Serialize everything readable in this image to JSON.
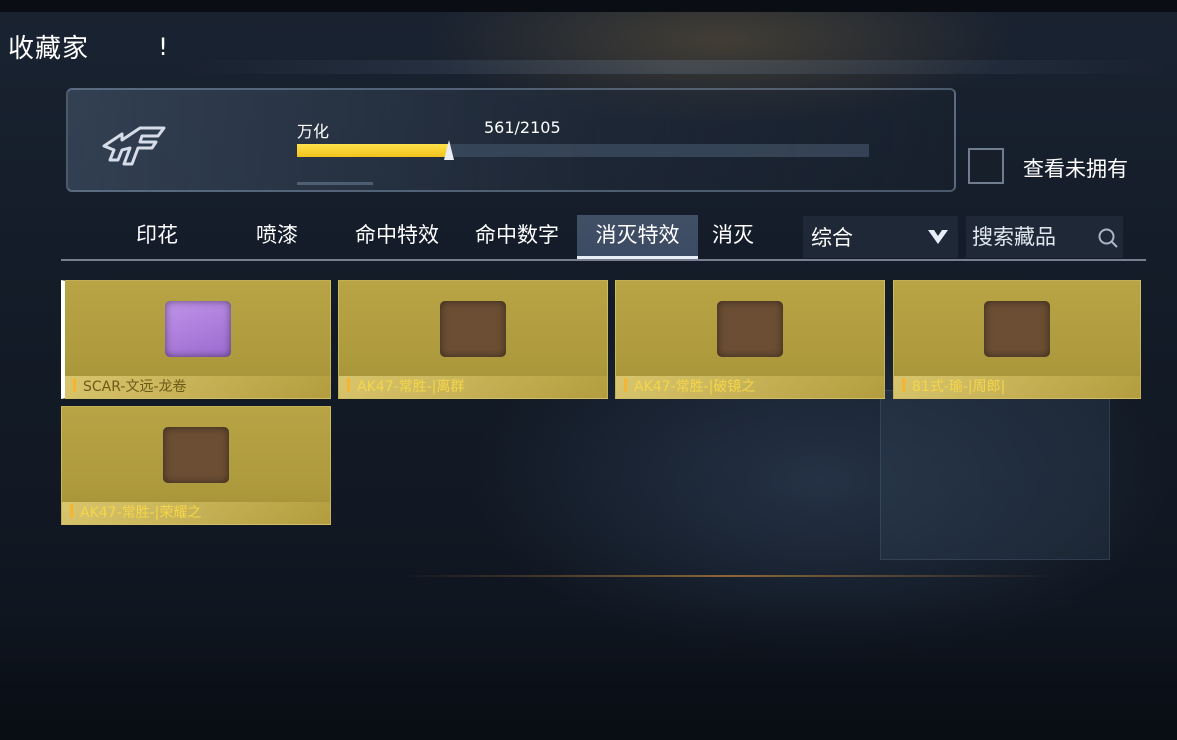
{
  "page": {
    "title": "收藏家",
    "info_icon": "info-icon"
  },
  "header": {
    "emblem_icon": "collector-emblem-icon",
    "progress_label": "万化",
    "progress_count": "561/2105",
    "progress_value": 0.2665,
    "show_unowned_label": "查看未拥有",
    "show_unowned_checked": false
  },
  "tabs": [
    {
      "label": "印花",
      "active": false
    },
    {
      "label": "喷漆",
      "active": false
    },
    {
      "label": "命中特效",
      "active": false
    },
    {
      "label": "命中数字",
      "active": false
    },
    {
      "label": "消灭特效",
      "active": true
    },
    {
      "label": "消灭",
      "active": false
    }
  ],
  "sort": {
    "selected": "综合",
    "icon": "chevron-down-icon"
  },
  "search": {
    "placeholder": "搜索藏品",
    "value": "",
    "icon": "search-icon"
  },
  "items": [
    {
      "name": "SCAR-文远-龙卷",
      "thumb_color": "#b285e0",
      "selected": true
    },
    {
      "name": "AK47-常胜-|离群",
      "thumb_color": "#6b4e33",
      "selected": false
    },
    {
      "name": "AK47-常胜-|破镜之",
      "thumb_color": "#6b4e33",
      "selected": false
    },
    {
      "name": "81式-瑜-|周郎|",
      "thumb_color": "#6b4e33",
      "selected": false
    },
    {
      "name": "AK47-常胜-|荣耀之",
      "thumb_color": "#6b4e33",
      "selected": false
    }
  ],
  "colors": {
    "accent": "#f2c21c",
    "card_gold": "#b8a445",
    "background": "#141c29"
  }
}
